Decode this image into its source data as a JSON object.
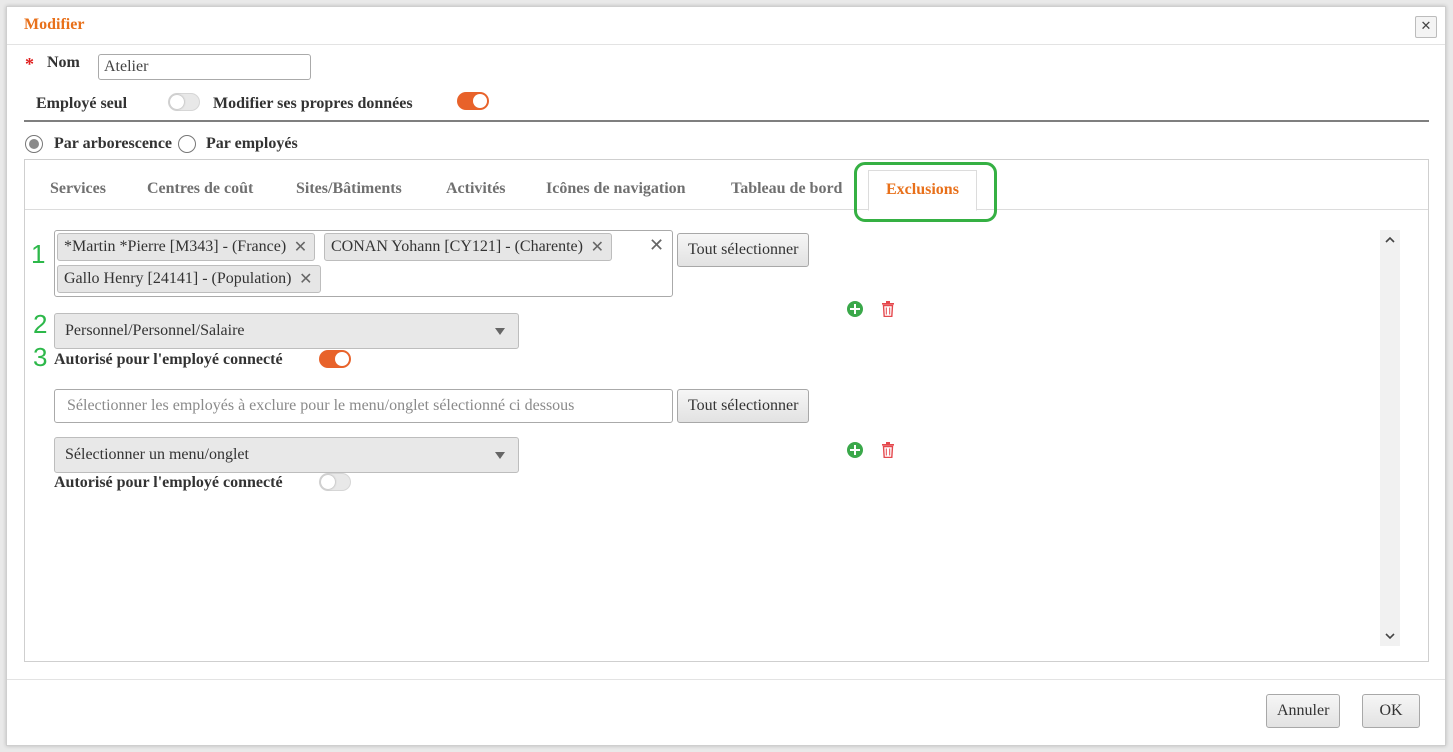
{
  "dialog": {
    "title": "Modifier",
    "close_symbol": "✕"
  },
  "form": {
    "required_marker": "*",
    "name_label": "Nom",
    "name_value": "Atelier",
    "employe_seul_label": "Employé seul",
    "employe_seul_on": false,
    "modifier_label": "Modifier ses propres données",
    "modifier_on": true
  },
  "mode": {
    "options": [
      "Par arborescence",
      "Par employés"
    ],
    "selected": "Par arborescence"
  },
  "tabs": {
    "items": [
      "Services",
      "Centres de coût",
      "Sites/Bâtiments",
      "Activités",
      "Icônes de navigation",
      "Tableau de bord",
      "Exclusions"
    ],
    "active": "Exclusions"
  },
  "annotations": [
    "1",
    "2",
    "3"
  ],
  "exclusions": [
    {
      "employees": [
        "*Martin *Pierre [M343] - (France)",
        "CONAN Yohann [CY121] - (Charente)",
        "Gallo Henry [24141] - (Population)"
      ],
      "chip_remove_symbol": "✕",
      "clear_symbol": "✕",
      "select_all_label": "Tout sélectionner",
      "menu_value": "Personnel/Personnel/Salaire",
      "authorized_label": "Autorisé pour l'employé connecté",
      "authorized_on": true
    },
    {
      "employees_placeholder": "Sélectionner les employés à exclure pour le menu/onglet sélectionné ci dessous",
      "select_all_label": "Tout sélectionner",
      "menu_placeholder": "Sélectionner un menu/onglet",
      "authorized_label": "Autorisé pour l'employé connecté",
      "authorized_on": false
    }
  ],
  "footer": {
    "cancel_label": "Annuler",
    "ok_label": "OK"
  },
  "colors": {
    "accent": "#e8701a",
    "toggle_on": "#e8622a",
    "highlight": "#35b043",
    "add": "#3aa84a",
    "delete": "#e5484d"
  },
  "icons": {
    "add": "plus-circle-icon",
    "delete": "trash-icon",
    "close": "close-icon",
    "scroll_up": "chevron-up-icon",
    "scroll_down": "chevron-down-icon"
  }
}
